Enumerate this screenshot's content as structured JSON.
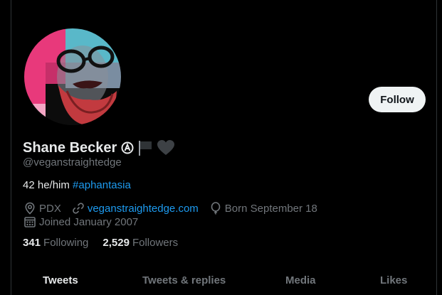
{
  "profile": {
    "display_name": "Shane Becker",
    "handle": "@veganstraightedge",
    "bio_text": "42 he/him ",
    "bio_hashtag": "#aphantasia",
    "location": "PDX",
    "website": "veganstraightedge.com",
    "birthday": "Born September 18",
    "joined": "Joined January 2007",
    "following_count": "341",
    "following_label": "Following",
    "followers_count": "2,529",
    "followers_label": "Followers",
    "name_icons": [
      "circled-a-icon",
      "black-flag-icon",
      "black-heart-icon"
    ]
  },
  "actions": {
    "follow_label": "Follow"
  },
  "tabs": [
    {
      "label": "Tweets",
      "active": true
    },
    {
      "label": "Tweets & replies",
      "active": false
    },
    {
      "label": "Media",
      "active": false
    },
    {
      "label": "Likes",
      "active": false
    }
  ],
  "colors": {
    "background": "#000000",
    "text": "#e7e9ea",
    "muted": "#71767b",
    "link": "#1d9bf0",
    "button_bg": "#eff3f4",
    "border": "#2f3336",
    "avatar_pink": "#e8397b",
    "avatar_cyan": "#59b8c9"
  }
}
